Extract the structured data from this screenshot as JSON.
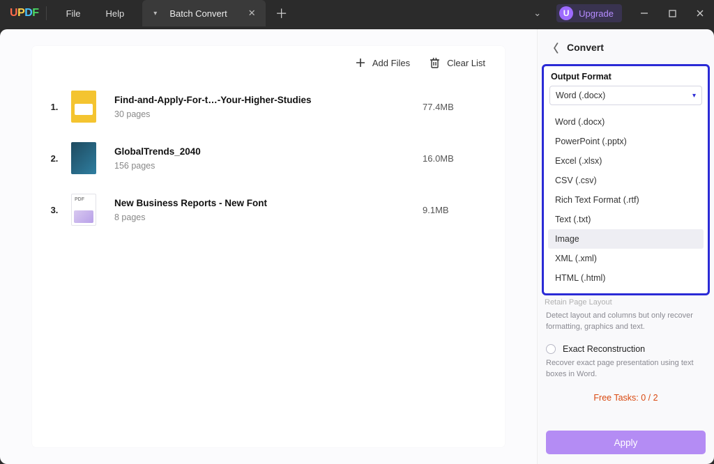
{
  "logo": {
    "l1": "U",
    "l2": "P",
    "l3": "D",
    "l4": "F"
  },
  "menu": {
    "file": "File",
    "help": "Help"
  },
  "tab": {
    "label": "Batch Convert"
  },
  "upgrade": {
    "badge": "U",
    "label": "Upgrade"
  },
  "toolbar": {
    "add_files": "Add Files",
    "clear_list": "Clear List"
  },
  "files": [
    {
      "idx": "1.",
      "name": "Find-and-Apply-For-t…-Your-Higher-Studies",
      "pages": "30 pages",
      "size": "77.4MB"
    },
    {
      "idx": "2.",
      "name": "GlobalTrends_2040",
      "pages": "156 pages",
      "size": "16.0MB"
    },
    {
      "idx": "3.",
      "name": "New Business Reports - New Font",
      "pages": "8 pages",
      "size": "9.1MB"
    }
  ],
  "side": {
    "title": "Convert",
    "output_format_label": "Output Format",
    "selected_format": "Word (.docx)",
    "options": [
      "Word (.docx)",
      "PowerPoint (.pptx)",
      "Excel (.xlsx)",
      "CSV (.csv)",
      "Rich Text Format (.rtf)",
      "Text (.txt)",
      "Image",
      "XML (.xml)",
      "HTML (.html)"
    ],
    "hovered_option_index": 6,
    "cutoff_option_text": "Retain Page Layout",
    "layout_desc": "Detect layout and columns but only recover formatting, graphics and text.",
    "exact_label": "Exact Reconstruction",
    "exact_desc": "Recover exact page presentation using text boxes in Word.",
    "free_tasks": "Free Tasks: 0 / 2",
    "apply": "Apply"
  },
  "pdf_badge": "PDF"
}
